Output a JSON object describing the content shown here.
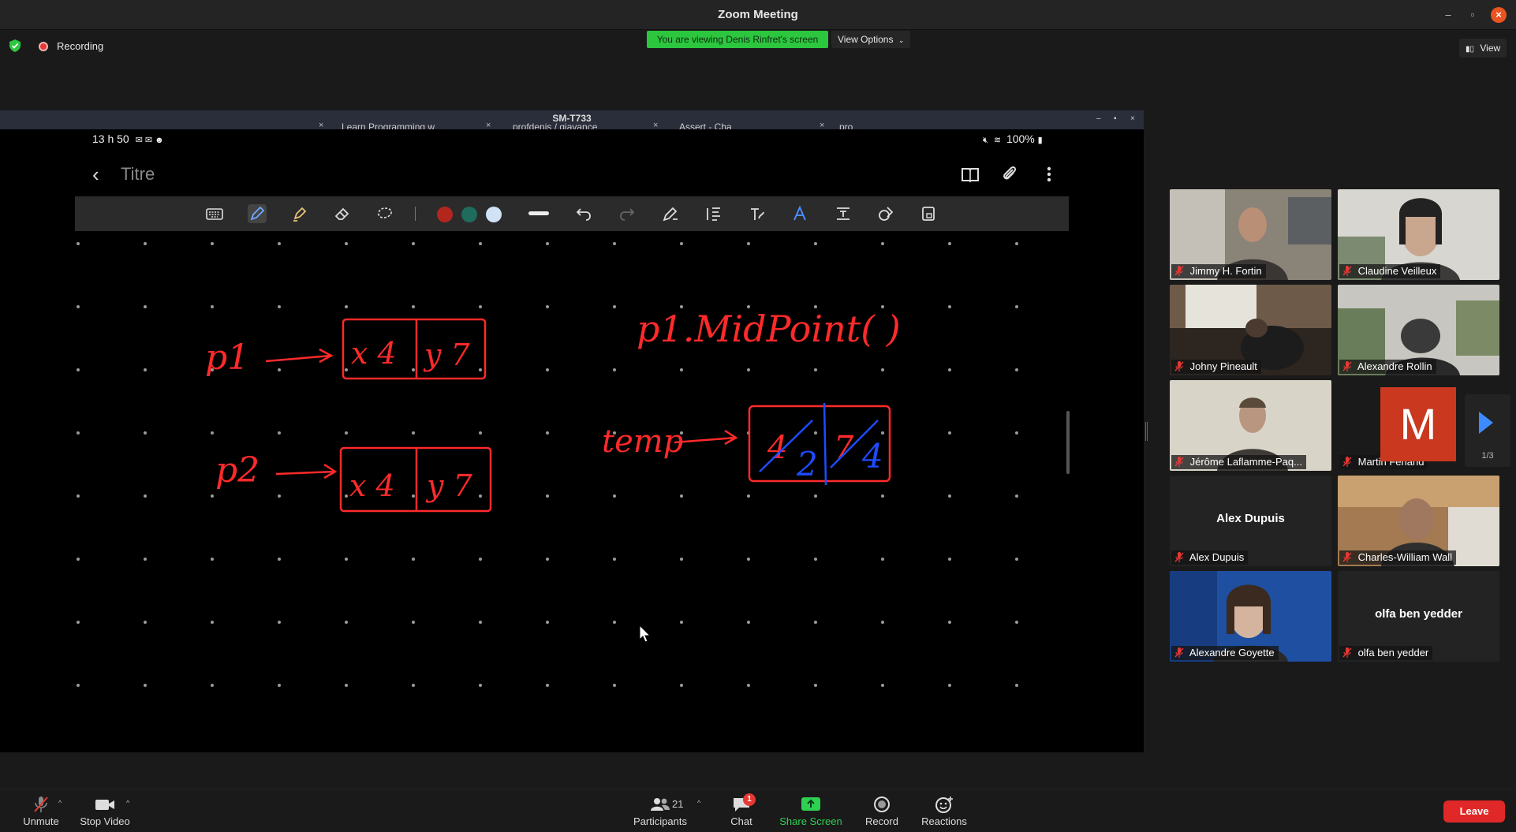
{
  "window": {
    "title": "Zoom Meeting"
  },
  "topbar": {
    "recording_label": "Recording",
    "viewing_banner": "You are viewing Denis Rinfret's screen",
    "view_options_label": "View Options",
    "view_label": "View"
  },
  "shared_screen": {
    "device_name": "SM-T733",
    "browser_tabs": [
      "Learn Programming w",
      "profdenis / giavance",
      "Assert - Cha",
      "pro"
    ],
    "status_time": "13 h 50",
    "status_battery": "100%",
    "note_title": "Titre",
    "pen_colors": [
      "#b3261e",
      "#1f6b5c",
      "#cfe3f5"
    ],
    "ink_color": "#ff2a2a",
    "correction_color": "#1e4bff",
    "handwriting": {
      "p1_label": "p1",
      "p2_label": "p2",
      "temp_label": "temp",
      "call": "p1.MidPoint( )",
      "p1_box": [
        "x 4",
        "y 7"
      ],
      "p2_box": [
        "x 4",
        "y 7"
      ],
      "temp_box_crossed": [
        "4",
        "7"
      ],
      "temp_box_new": [
        "2",
        "4"
      ]
    }
  },
  "participants": {
    "tiles": [
      {
        "name": "Jimmy H. Fortin",
        "video": true
      },
      {
        "name": "Claudine Veilleux",
        "video": true
      },
      {
        "name": "Johny Pineault",
        "video": true
      },
      {
        "name": "Alexandre Rollin",
        "video": true
      },
      {
        "name": "Jérôme Laflamme-Paq...",
        "video": true
      },
      {
        "name": "Martin Ferland",
        "video": false,
        "avatar_letter": "M"
      },
      {
        "name": "Alex Dupuis",
        "video": false,
        "center_name": "Alex Dupuis"
      },
      {
        "name": "Charles-William Wall",
        "video": true
      },
      {
        "name": "Alexandre Goyette",
        "video": true
      },
      {
        "name": "olfa ben yedder",
        "video": false,
        "center_name": "olfa ben yedder"
      }
    ],
    "page_indicator": "1/3"
  },
  "toolbar": {
    "unmute": "Unmute",
    "stop_video": "Stop Video",
    "participants": "Participants",
    "participants_count": "21",
    "chat": "Chat",
    "chat_badge": "1",
    "share_screen": "Share Screen",
    "record": "Record",
    "reactions": "Reactions",
    "leave": "Leave"
  }
}
